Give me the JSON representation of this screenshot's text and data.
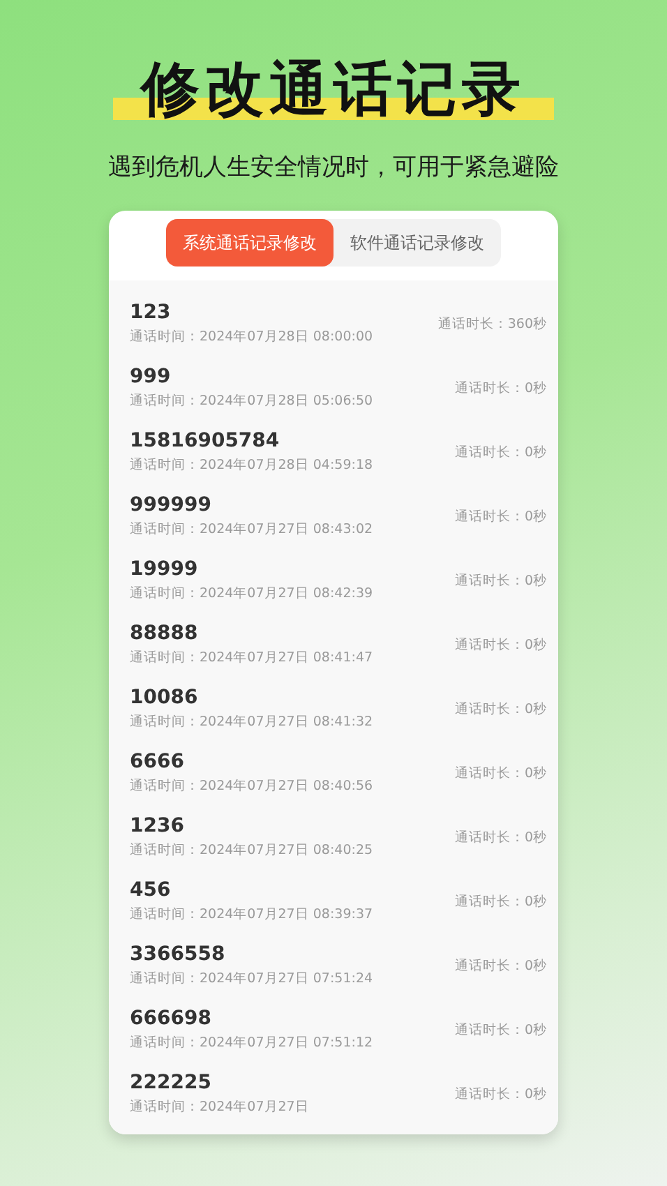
{
  "headline": "修改通话记录",
  "subtitle": "遇到危机人生安全情况时，可用于紧急避险",
  "tabs": [
    {
      "label": "系统通话记录修改",
      "selected": true
    },
    {
      "label": "软件通话记录修改",
      "selected": false
    }
  ],
  "records": [
    {
      "number": "123",
      "time": "通话时间：2024年07月28日 08:00:00",
      "duration": "通话时长：360秒"
    },
    {
      "number": "999",
      "time": "通话时间：2024年07月28日 05:06:50",
      "duration": "通话时长：0秒"
    },
    {
      "number": "15816905784",
      "time": "通话时间：2024年07月28日 04:59:18",
      "duration": "通话时长：0秒"
    },
    {
      "number": "999999",
      "time": "通话时间：2024年07月27日 08:43:02",
      "duration": "通话时长：0秒"
    },
    {
      "number": "19999",
      "time": "通话时间：2024年07月27日 08:42:39",
      "duration": "通话时长：0秒"
    },
    {
      "number": "88888",
      "time": "通话时间：2024年07月27日 08:41:47",
      "duration": "通话时长：0秒"
    },
    {
      "number": "10086",
      "time": "通话时间：2024年07月27日 08:41:32",
      "duration": "通话时长：0秒"
    },
    {
      "number": "6666",
      "time": "通话时间：2024年07月27日 08:40:56",
      "duration": "通话时长：0秒"
    },
    {
      "number": "1236",
      "time": "通话时间：2024年07月27日 08:40:25",
      "duration": "通话时长：0秒"
    },
    {
      "number": "456",
      "time": "通话时间：2024年07月27日 08:39:37",
      "duration": "通话时长：0秒"
    },
    {
      "number": "3366558",
      "time": "通话时间：2024年07月27日 07:51:24",
      "duration": "通话时长：0秒"
    },
    {
      "number": "666698",
      "time": "通话时间：2024年07月27日 07:51:12",
      "duration": "通话时长：0秒"
    },
    {
      "number": "222225",
      "time": "通话时间：2024年07月27日",
      "duration": "通话时长：0秒"
    }
  ]
}
